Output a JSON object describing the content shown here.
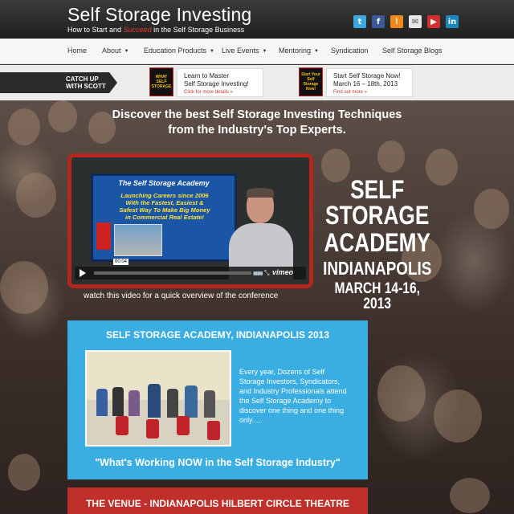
{
  "header": {
    "title": "Self Storage Investing",
    "tagline_pre": "How to Start and ",
    "tagline_em": "Succeed",
    "tagline_post": " in the Self Storage Business",
    "social": [
      {
        "icon": "twitter-icon",
        "glyph": "t",
        "color": "#3aa7e0"
      },
      {
        "icon": "facebook-icon",
        "glyph": "f",
        "color": "#3b5998"
      },
      {
        "icon": "rss-icon",
        "glyph": "⌇",
        "color": "#ef8a1a"
      },
      {
        "icon": "email-icon",
        "glyph": "✉",
        "color": "#e8e8e8"
      },
      {
        "icon": "youtube-icon",
        "glyph": "▶",
        "color": "#d32f2f"
      },
      {
        "icon": "linkedin-icon",
        "glyph": "in",
        "color": "#1c87bd"
      }
    ]
  },
  "nav": {
    "items": [
      {
        "label": "Home",
        "caret": ""
      },
      {
        "label": "About",
        "caret": "▼"
      },
      {
        "label": "Education Products",
        "caret": "▼"
      },
      {
        "label": "Live Events",
        "caret": "▼"
      },
      {
        "label": "Mentoring",
        "caret": "▼"
      },
      {
        "label": "Syndication",
        "caret": ""
      },
      {
        "label": "Self Storage Blogs",
        "caret": ""
      }
    ]
  },
  "promo": {
    "catch_line1": "CATCH UP",
    "catch_line2": "WITH SCOTT",
    "box1": {
      "thumb": "WHAT SELF STORAGE",
      "line1": "Learn to Master",
      "line2": "Self Storage Investing!",
      "link": "Click for more details »"
    },
    "box2": {
      "thumb": "Start Your Self Storage Now!",
      "line1": "Start Self Storage Now!",
      "line2": "March 16 – 18th, 2013",
      "link": "Find out more »"
    }
  },
  "hero": {
    "headline_line1": "Discover the best Self Storage Investing Techniques",
    "headline_line2": "from the Industry's Top Experts.",
    "video": {
      "board_title": "The Self Storage Academy",
      "board_line1": "Launching Careers since 2006",
      "board_line2": "With the Fastest, Easiest &",
      "board_line3": "Safest Way To Make Big Money",
      "board_line4": "in Commercial Real Estate!",
      "time": "00:04",
      "brand": "vimeo"
    },
    "video_caption": "watch this video for a quick overview of the conference",
    "academy": {
      "line1": "SELF STORAGE",
      "line2": "ACADEMY",
      "line3": "INDIANAPOLIS",
      "line4": "MARCH 14-16, 2013"
    }
  },
  "blue_box": {
    "title": "SELF STORAGE ACADEMY, INDIANAPOLIS 2013",
    "text": "Every year, Dozens of Self Storage Investors, Syndicators, and Industry Professionals attend the Self Storage Academy to discover one thing and one thing only.....",
    "quote": "\"What's Working NOW in the Self Storage Industry\""
  },
  "venue": {
    "title": "THE VENUE - INDIANAPOLIS HILBERT CIRCLE THEATRE"
  }
}
